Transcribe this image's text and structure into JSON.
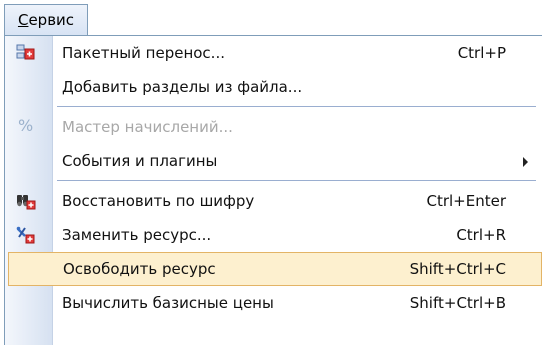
{
  "menubar": {
    "menu_first_letter": "С",
    "menu_rest": "ервис"
  },
  "menu": {
    "items": [
      {
        "label": "Пакетный перенос...",
        "shortcut": "Ctrl+P",
        "icon": "batch-transfer-icon"
      },
      {
        "label": "Добавить разделы из файла...",
        "shortcut": ""
      },
      {
        "label": "Мастер начислений...",
        "shortcut": "",
        "icon": "percent-icon",
        "disabled": true
      },
      {
        "label": "События и плагины",
        "shortcut": "",
        "submenu": true
      },
      {
        "label": "Восстановить по шифру",
        "shortcut": "Ctrl+Enter",
        "icon": "binoculars-icon"
      },
      {
        "label": "Заменить ресурс...",
        "shortcut": "Ctrl+R",
        "icon": "replace-resource-icon"
      },
      {
        "label": "Освободить ресурс",
        "shortcut": "Shift+Ctrl+C",
        "highlighted": true
      },
      {
        "label": "Вычислить базисные цены",
        "shortcut": "Shift+Ctrl+B"
      }
    ],
    "percent_glyph": "%"
  },
  "colors": {
    "highlight_bg": "#fdf0cf",
    "highlight_border": "#e3b466",
    "separator": "#9aaed0",
    "disabled_text": "#a8a8a8"
  }
}
